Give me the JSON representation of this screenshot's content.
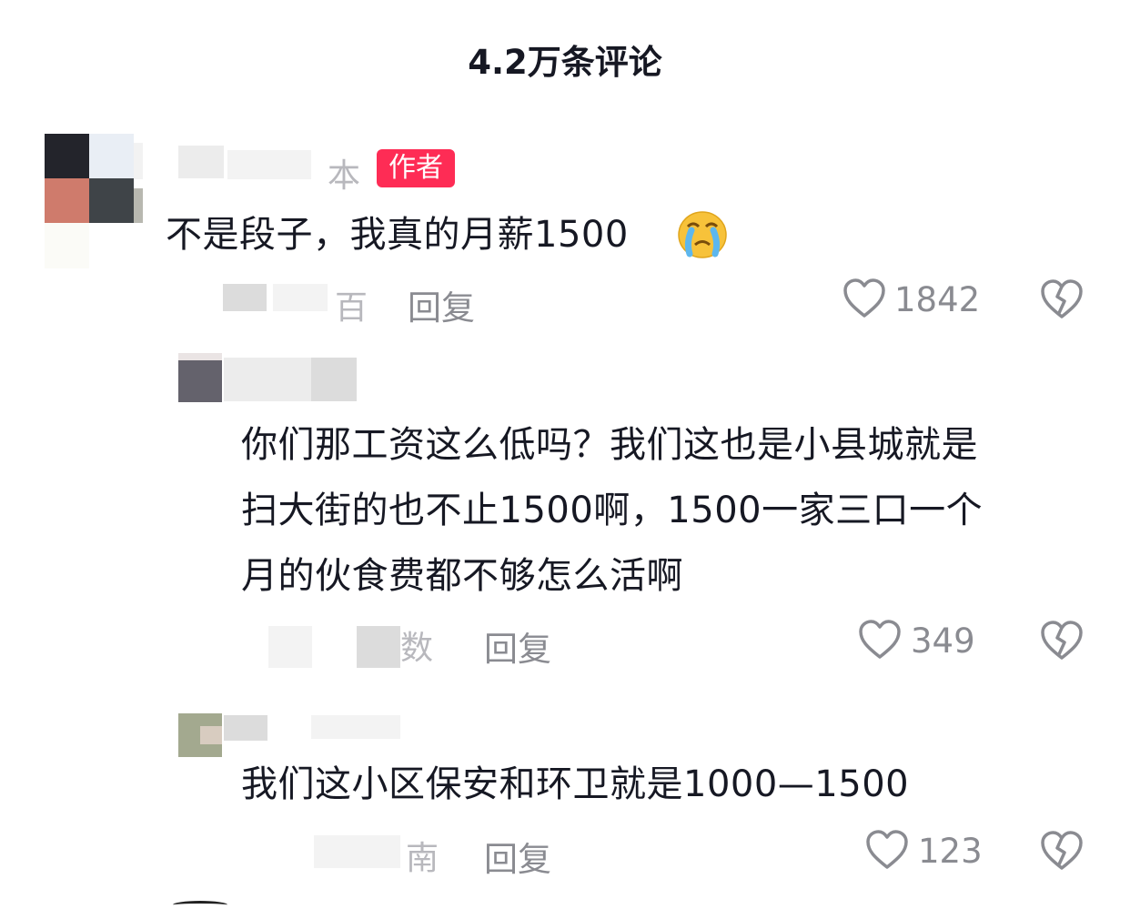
{
  "header": {
    "title": "4.2万条评论"
  },
  "comments": [
    {
      "name_fragment": "本",
      "badge": "作者",
      "text": "不是段子，我真的月薪1500",
      "emoji": "crying-face-emoji",
      "meta_fragment": "百",
      "reply_label": "回复",
      "likes": "1842"
    }
  ],
  "replies": [
    {
      "text_lines": [
        "你们那工资这么低吗？我们这也是小县城就是",
        "扫大街的也不止1500啊，1500一家三口一个",
        "月的伙食费都不够怎么活啊"
      ],
      "meta_fragment": "数",
      "reply_label": "回复",
      "likes": "349"
    },
    {
      "text_lines": [
        "我们这小区保安和环卫就是1000—1500"
      ],
      "meta_fragment": "南",
      "reply_label": "回复",
      "likes": "123"
    }
  ],
  "icons": {
    "like": "heart-outline-icon",
    "dislike": "broken-heart-icon"
  },
  "colors": {
    "badge": "#fe2c55",
    "secondary_text": "#8a8b91",
    "primary_text": "#161823"
  }
}
